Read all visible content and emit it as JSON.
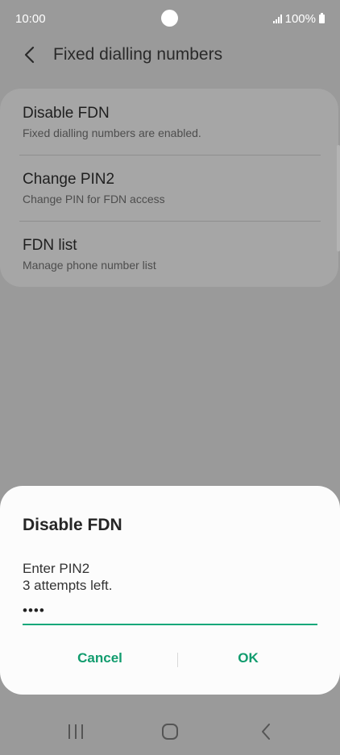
{
  "status_bar": {
    "time": "10:00",
    "battery": "100%"
  },
  "app_bar": {
    "title": "Fixed dialling numbers"
  },
  "settings": [
    {
      "title": "Disable FDN",
      "subtitle": "Fixed dialling numbers are enabled."
    },
    {
      "title": "Change PIN2",
      "subtitle": "Change PIN for FDN access"
    },
    {
      "title": "FDN list",
      "subtitle": "Manage phone number list"
    }
  ],
  "dialog": {
    "title": "Disable FDN",
    "prompt_line1": "Enter PIN2",
    "prompt_line2": "3 attempts left.",
    "pin_value": "••••",
    "cancel_label": "Cancel",
    "ok_label": "OK"
  },
  "colors": {
    "accent": "#119c6e",
    "input_underline": "#14a87a",
    "scrim": "#9a9a9a"
  },
  "icons": {
    "back": "back-arrow-icon",
    "recent": "recent-apps-icon",
    "home": "home-icon",
    "nav_back": "nav-back-icon"
  }
}
